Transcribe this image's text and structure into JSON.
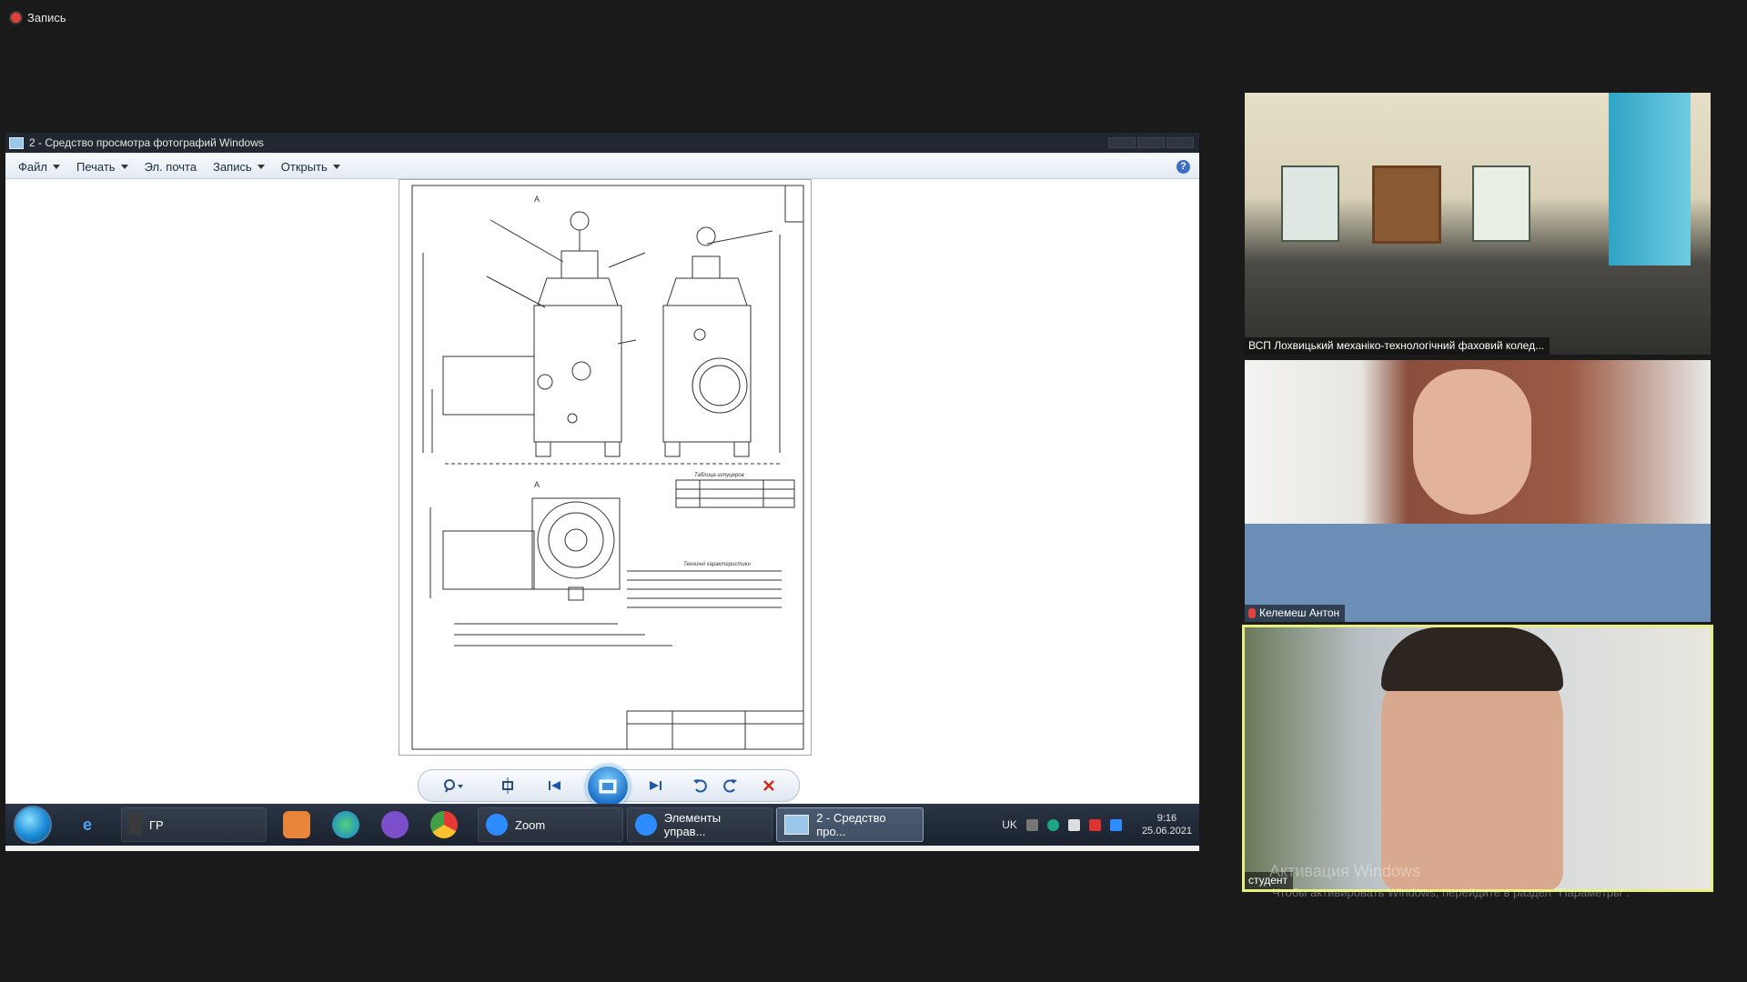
{
  "recording": {
    "label": "Запись"
  },
  "screen": {
    "window_title": "2 - Средство просмотра фотографий Windows",
    "menu": [
      {
        "label": "Файл",
        "has_dropdown": true
      },
      {
        "label": "Печать",
        "has_dropdown": true
      },
      {
        "label": "Эл. почта",
        "has_dropdown": false
      },
      {
        "label": "Запись",
        "has_dropdown": true
      },
      {
        "label": "Открыть",
        "has_dropdown": true
      }
    ],
    "drawing": {
      "view_label_top": "А",
      "view_label_bottom": "А",
      "table_title": "Таблица штуцеров",
      "tech_title": "Техничні характеристики"
    },
    "viewer_controls": [
      "zoom",
      "actual-size",
      "previous",
      "slideshow",
      "next",
      "rotate-left",
      "rotate-right",
      "delete"
    ]
  },
  "taskbar": {
    "buttons": [
      {
        "label": "ГР"
      },
      {
        "label": "Zoom"
      },
      {
        "label": "Элементы управ..."
      },
      {
        "label": "2 - Средство про..."
      }
    ],
    "tray_language": "UK",
    "time": "9:16",
    "date": "25.06.2021"
  },
  "participants": [
    {
      "name": "ВСП Лохвицький механіко-технологічний фаховий колед...",
      "muted": false
    },
    {
      "name": "Келемеш Антон",
      "muted": true
    },
    {
      "name": "студент",
      "muted": false,
      "active_speaker": true
    }
  ],
  "watermark": {
    "line1": "Активация Windows",
    "line2": "Чтобы активировать Windows, перейдите в раздел \"Параметры\"."
  }
}
